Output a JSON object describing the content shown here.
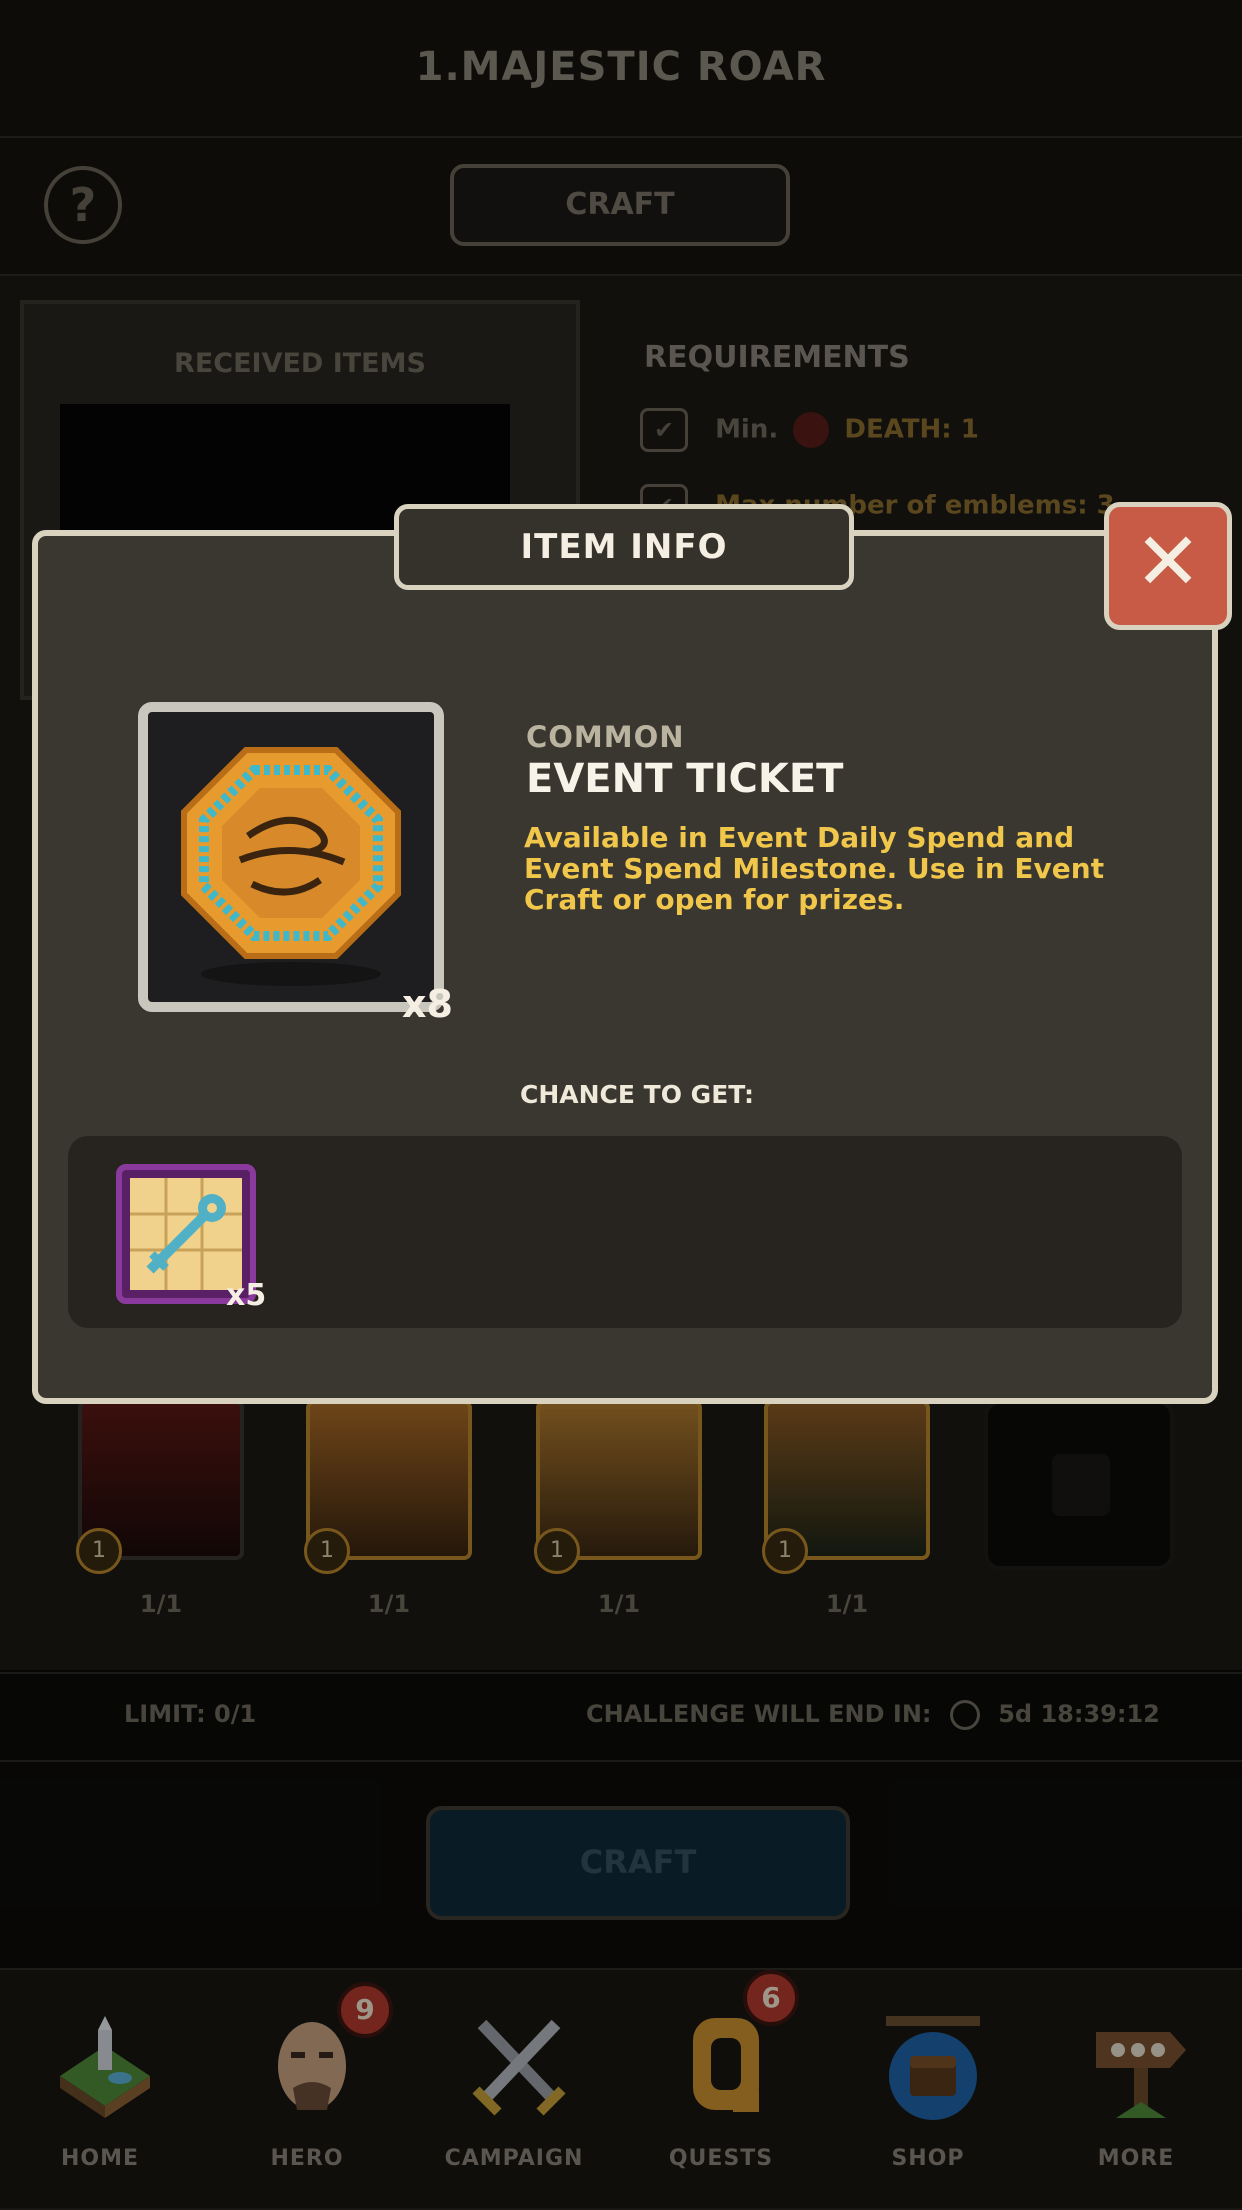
{
  "header": {
    "title": "1.MAJESTIC ROAR"
  },
  "subbar": {
    "help_label": "?",
    "craft_tab_label": "CRAFT"
  },
  "received": {
    "title": "RECEIVED ITEMS"
  },
  "requirements": {
    "title": "REQUIREMENTS",
    "row1_prefix": "Min.",
    "row1_value": "DEATH: 1",
    "row2_text": "Max number of emblems: 3"
  },
  "cards": [
    {
      "level": "1",
      "count": "1/1"
    },
    {
      "level": "1",
      "count": "1/1"
    },
    {
      "level": "1",
      "count": "1/1"
    },
    {
      "level": "1",
      "count": "1/1"
    }
  ],
  "limit_bar": {
    "limit": "LIMIT: 0/1",
    "challenge_label": "CHALLENGE WILL END IN:",
    "time": "5d 18:39:12"
  },
  "craft_button": "CRAFT",
  "nav": {
    "home": "HOME",
    "hero": "HERO",
    "hero_badge": "9",
    "campaign": "CAMPAIGN",
    "quests": "QUESTS",
    "quests_badge": "6",
    "shop": "SHOP",
    "more": "MORE"
  },
  "modal": {
    "title": "ITEM INFO",
    "close": "✕",
    "item_count": "x8",
    "rarity": "COMMON",
    "name": "EVENT TICKET",
    "description": "Available in Event Daily Spend and Event Spend Milestone. Use in Event Craft or open for prizes.",
    "chance_label": "CHANCE TO GET:",
    "prize_count": "x5"
  },
  "colors": {
    "accent_gold": "#f0c64b",
    "close_red": "#c85b46",
    "frame": "#d9d2bf"
  }
}
